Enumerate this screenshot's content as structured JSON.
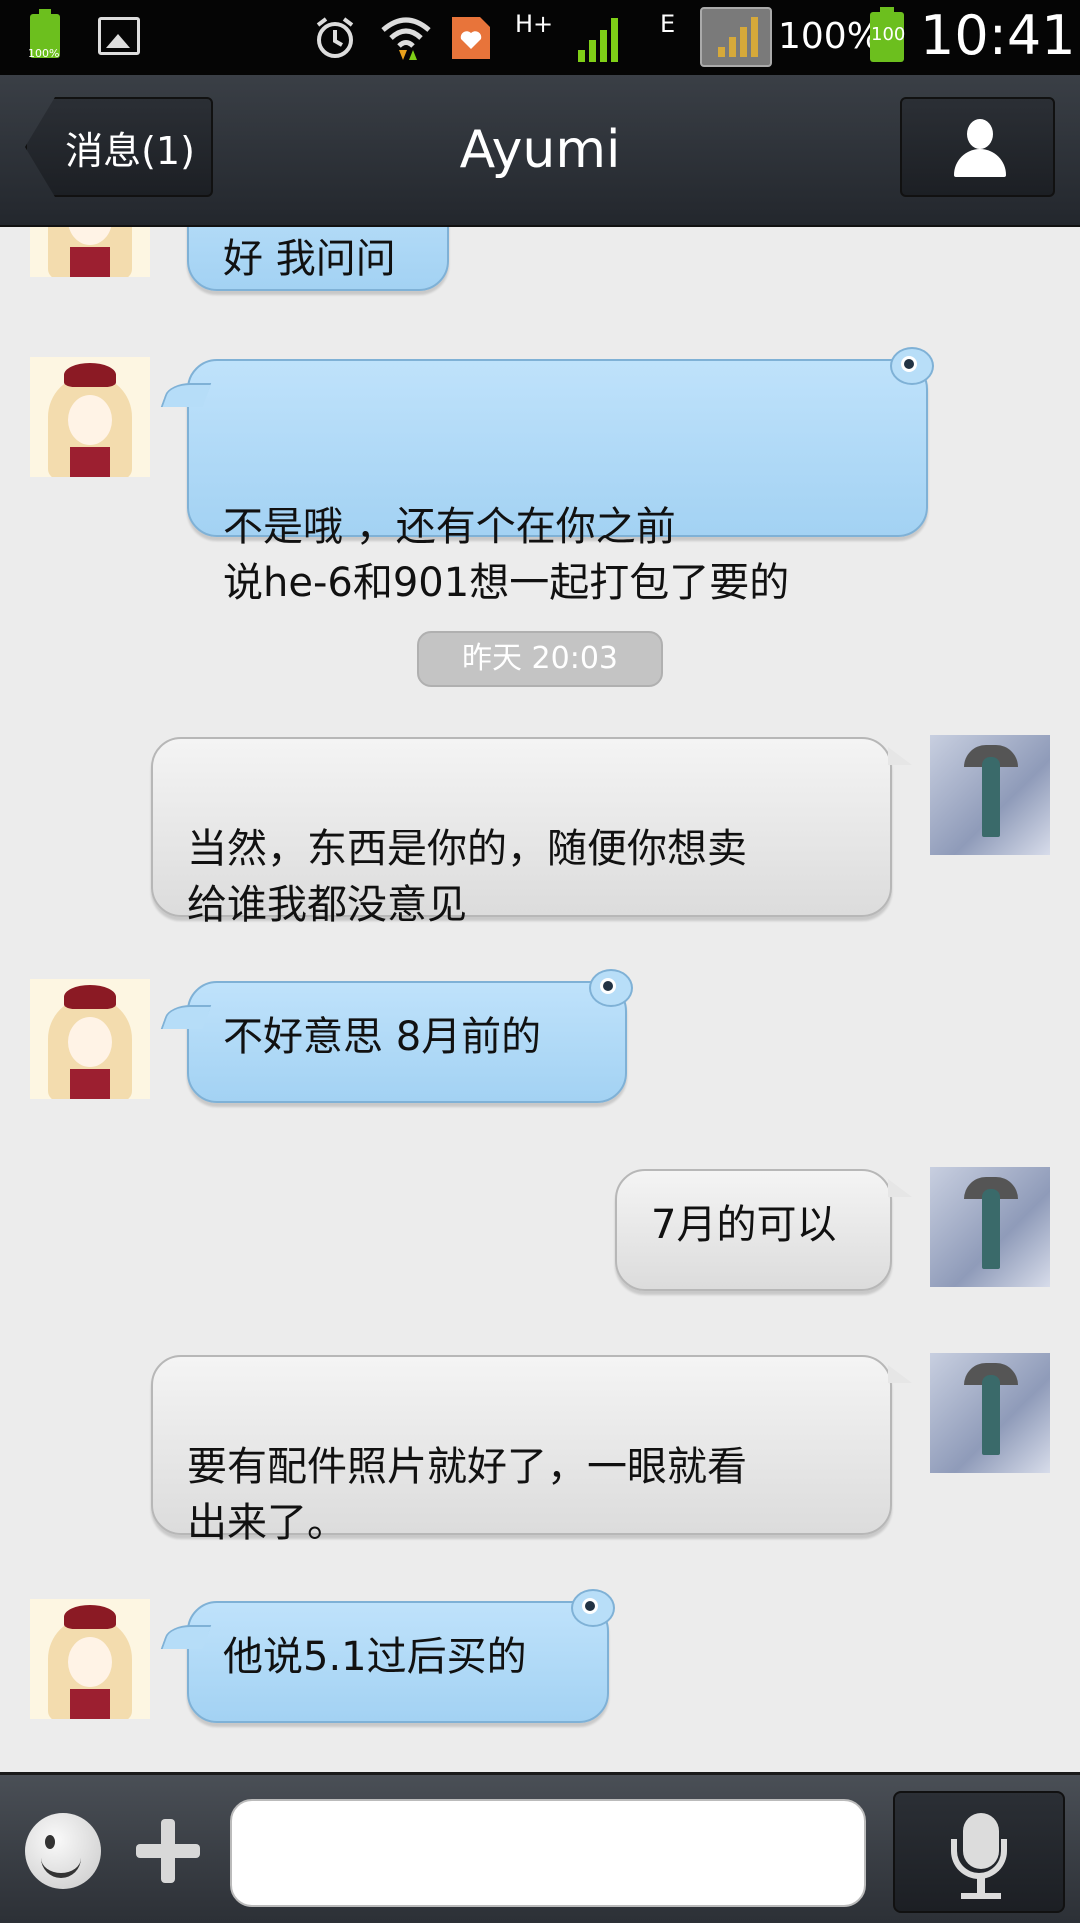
{
  "status_bar": {
    "battery_small_label": "100%",
    "network_type": "H+",
    "network_type2": "E",
    "battery_percent": "100%",
    "battery_icon_label": "100",
    "time": "10:41"
  },
  "nav": {
    "back_label": "消息(1)",
    "title": "Ayumi"
  },
  "chat": {
    "messages": [
      {
        "sender": "Ayumi",
        "text": "好 我问问"
      },
      {
        "sender": "Ayumi",
        "text": "不是哦 ，还有个在你之前\n说he-6和901想一起打包了要的"
      },
      {
        "sender": "me",
        "text": "当然，东西是你的，随便你想卖\n给谁我都没意见"
      },
      {
        "sender": "Ayumi",
        "text": "不好意思 8月前的"
      },
      {
        "sender": "me",
        "text": "7月的可以"
      },
      {
        "sender": "me",
        "text": "要有配件照片就好了，一眼就看\n出来了。"
      },
      {
        "sender": "Ayumi",
        "text": "他说5.1过后买的"
      }
    ],
    "timestamp": "昨天 20:03"
  },
  "input": {
    "value": ""
  },
  "icons": {
    "back": "chevron-left",
    "profile": "person-icon",
    "emoji": "smiley-icon",
    "attach": "plus-icon",
    "voice": "microphone-icon"
  },
  "colors": {
    "incoming_bubble": "#a3d2f3",
    "outgoing_bubble": "#e6e6e6",
    "navbar": "#2b2f35",
    "chat_bg": "#ececec"
  }
}
